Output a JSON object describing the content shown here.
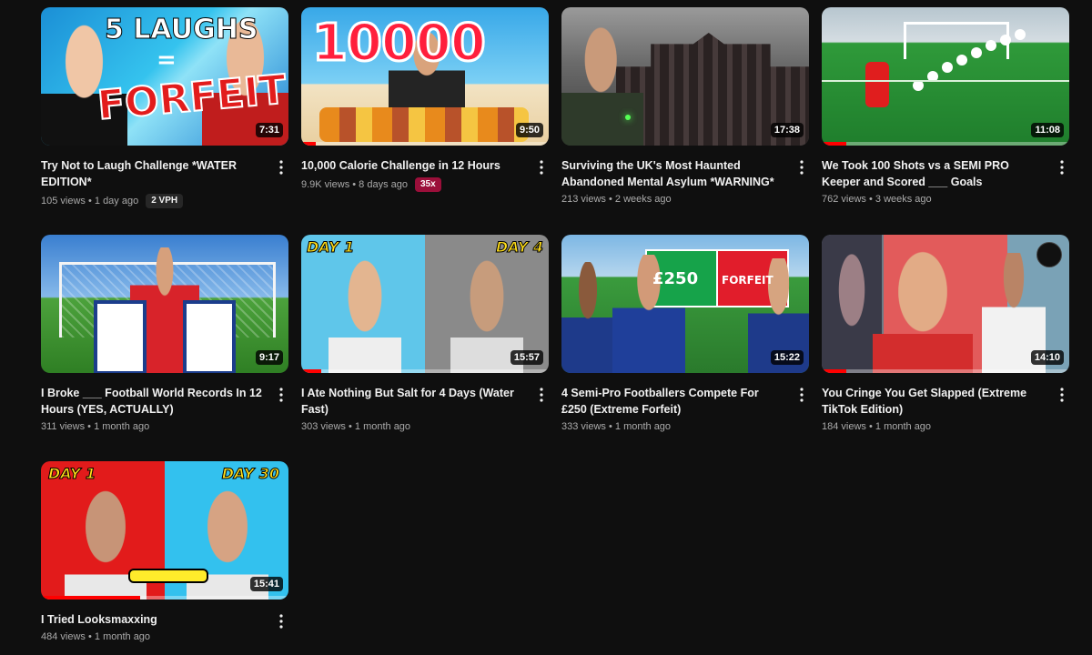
{
  "videos": [
    {
      "title": "Try Not to Laugh Challenge *WATER EDITION*",
      "views": "105 views",
      "age": "1 day ago",
      "duration": "7:31",
      "badge": "2 VPH",
      "badge_type": "vph",
      "progress": 0,
      "thumb_texts": [
        "5 LAUGHS",
        "=",
        "FORFEIT"
      ]
    },
    {
      "title": "10,000 Calorie Challenge in 12 Hours",
      "views": "9.9K views",
      "age": "8 days ago",
      "duration": "9:50",
      "badge": "35x",
      "badge_type": "mult",
      "progress": 0.06,
      "thumb_texts": [
        "10000"
      ]
    },
    {
      "title": "Surviving the UK's Most Haunted Abandoned Mental Asylum *WARNING*",
      "views": "213 views",
      "age": "2 weeks ago",
      "duration": "17:38",
      "badge": "",
      "badge_type": "",
      "progress": 0,
      "thumb_texts": []
    },
    {
      "title": "We Took 100 Shots vs a SEMI PRO Keeper and Scored ___ Goals",
      "views": "762 views",
      "age": "3 weeks ago",
      "duration": "11:08",
      "badge": "",
      "badge_type": "",
      "progress": 0.1,
      "thumb_texts": []
    },
    {
      "title": "I Broke ___ Football World Records In 12 Hours (YES, ACTUALLY)",
      "views": "311 views",
      "age": "1 month ago",
      "duration": "9:17",
      "badge": "",
      "badge_type": "",
      "progress": 0,
      "thumb_texts": []
    },
    {
      "title": "I Ate Nothing But Salt for 4 Days (Water Fast)",
      "views": "303 views",
      "age": "1 month ago",
      "duration": "15:57",
      "badge": "",
      "badge_type": "",
      "progress": 0.08,
      "thumb_texts": [
        "DAY 1",
        "DAY 4"
      ]
    },
    {
      "title": "4 Semi-Pro Footballers Compete For £250 (Extreme Forfeit)",
      "views": "333 views",
      "age": "1 month ago",
      "duration": "15:22",
      "badge": "",
      "badge_type": "",
      "progress": 0,
      "thumb_texts": [
        "£250",
        "FORFEIT"
      ]
    },
    {
      "title": "You Cringe You Get Slapped (Extreme TikTok Edition)",
      "views": "184 views",
      "age": "1 month ago",
      "duration": "14:10",
      "badge": "",
      "badge_type": "",
      "progress": 0.1,
      "thumb_texts": []
    },
    {
      "title": "I Tried Looksmaxxing",
      "views": "484 views",
      "age": "1 month ago",
      "duration": "15:41",
      "badge": "",
      "badge_type": "",
      "progress": 0.4,
      "thumb_texts": [
        "DAY 1",
        "DAY 30"
      ]
    }
  ],
  "colors": {
    "background": "#0f0f0f",
    "progress": "#ff0000",
    "meta_text": "#aaaaaa",
    "badge_mult": "#9b0f3a",
    "badge_vph": "#272727"
  },
  "icons": {
    "more": "more-vert-icon"
  }
}
